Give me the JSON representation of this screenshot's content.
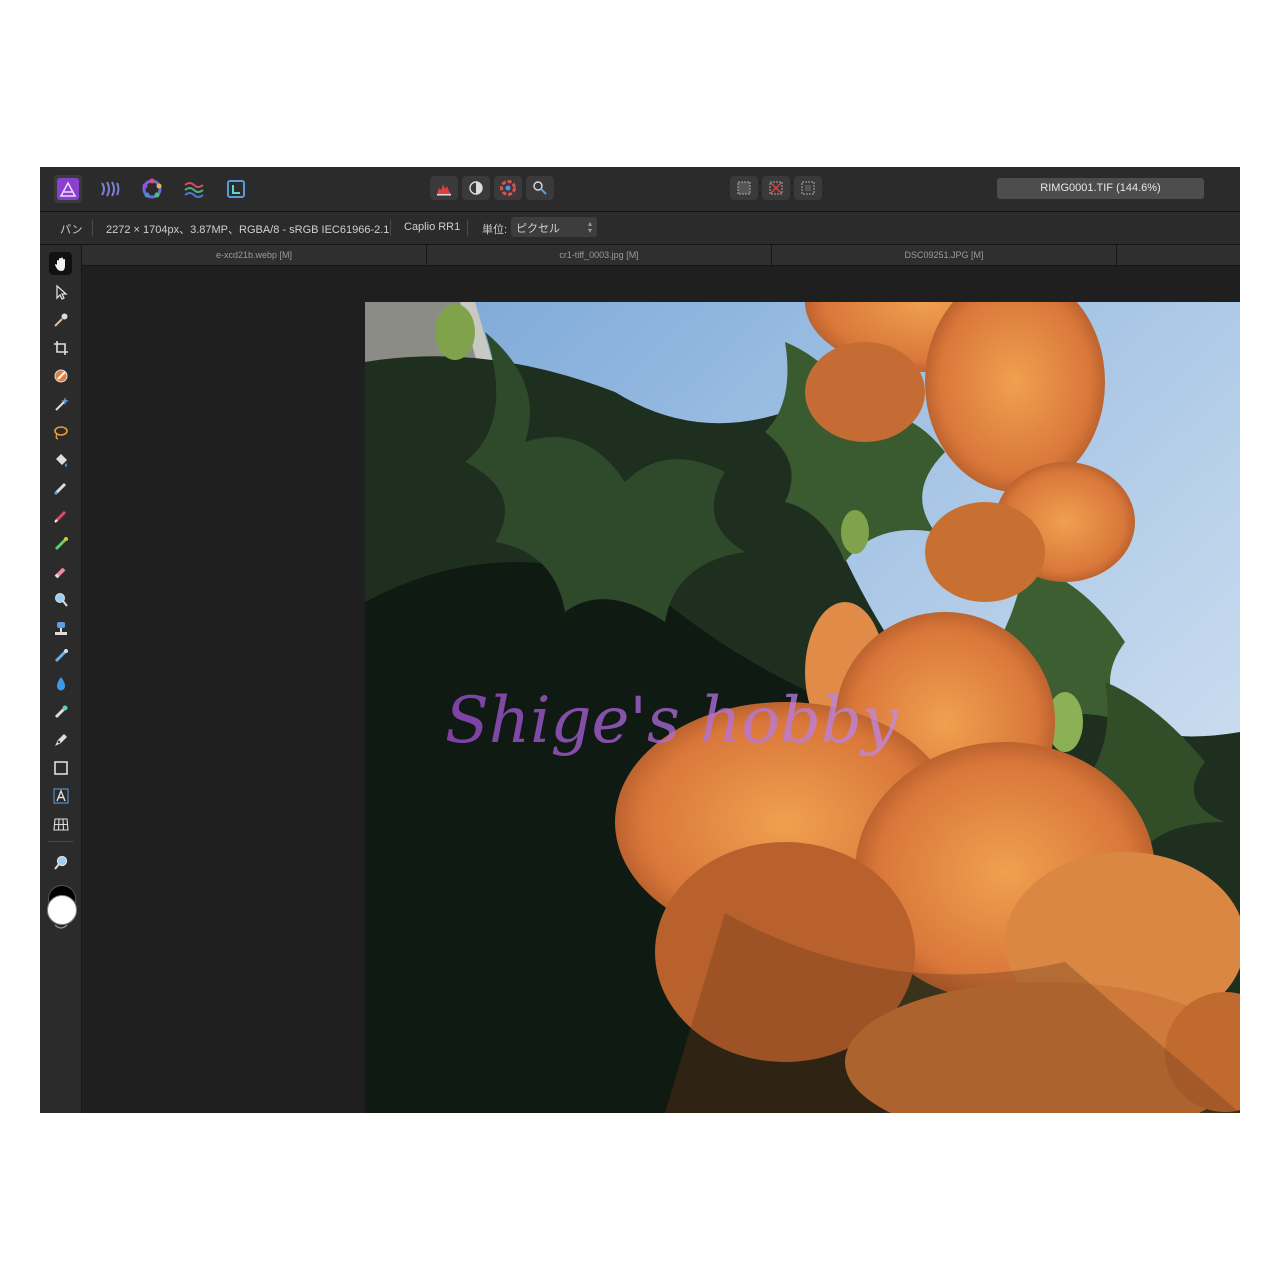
{
  "toolbar": {
    "personas": [
      "photo-persona",
      "liquify-persona",
      "develop-persona",
      "tone-mapping-persona",
      "export-persona"
    ],
    "center_tools": [
      "histogram-icon",
      "auto-contrast-icon",
      "color-wheel-icon",
      "white-balance-icon"
    ],
    "selection_tools": [
      "select-all-icon",
      "deselect-icon",
      "invert-selection-icon"
    ],
    "document_title": "RIMG0001.TIF (144.6%)"
  },
  "context": {
    "tool_name": "パン",
    "image_info": "2272 × 1704px、3.87MP、RGBA/8 - sRGB IEC61966-2.1",
    "camera": "Caplio RR1",
    "unit_label": "単位:",
    "unit_value": "ピクセル"
  },
  "tabs": [
    {
      "label": "e-xcd21b.webp [M]"
    },
    {
      "label": "cr1-tiff_0003.jpg [M]"
    },
    {
      "label": "DSC09251.JPG [M]"
    }
  ],
  "tools": [
    "hand-icon",
    "move-icon",
    "eyedropper-icon",
    "crop-icon",
    "selection-brush-icon",
    "magic-wand-icon",
    "freehand-selection-icon",
    "flood-fill-icon",
    "paint-brush-icon",
    "pencil-icon",
    "color-replacement-icon",
    "erase-icon",
    "dodge-icon",
    "clone-icon",
    "healing-icon",
    "blur-icon",
    "smudge-icon",
    "pen-icon",
    "rectangle-icon",
    "artistic-text-icon",
    "mesh-warp-icon",
    "zoom-icon"
  ],
  "colors": {
    "primary": "#000000",
    "secondary": "#ffffff",
    "accent": "#a24fd6"
  },
  "watermark": "Shige's hobby"
}
